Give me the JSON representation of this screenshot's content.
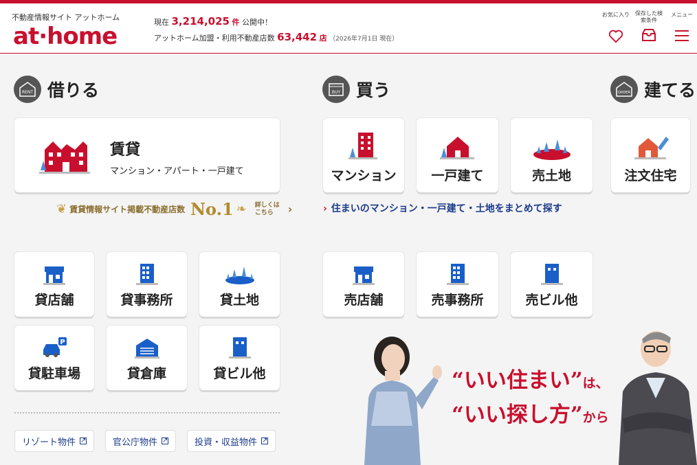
{
  "header": {
    "tagline": "不動産情報サイト アットホーム",
    "logo": "athome",
    "stats": {
      "prefix": "現在",
      "count": "3,214,025",
      "count_unit": "件",
      "public": "公開中！",
      "stores_label": "アットホーム加盟・利用不動産店数",
      "stores": "63,442",
      "stores_unit": "店",
      "as_of": "（2026年7月1日 現在）"
    },
    "icons": [
      {
        "label": "お気に入り",
        "icon": "heart-icon"
      },
      {
        "label": "保存した検索条件",
        "icon": "inbox-icon"
      },
      {
        "label": "メニュー",
        "icon": "menu-icon"
      }
    ]
  },
  "sections": {
    "rent": {
      "badge": "RENT",
      "title": "借りる"
    },
    "buy": {
      "badge": "BUY",
      "title": "買う"
    },
    "build": {
      "badge": "ORDER",
      "title": "建てる"
    }
  },
  "rent_main": {
    "title": "賃貸",
    "subtitle": "マンション・アパート・一戸建て"
  },
  "no1": {
    "text": "賃貸情報サイト掲載不動産店数",
    "rank": "No.1",
    "more": "詳しくはこちら"
  },
  "rent_cards": [
    "貸店舗",
    "貸事務所",
    "貸土地",
    "貸駐車場",
    "貸倉庫",
    "貸ビル他"
  ],
  "buy_cards": [
    "マンション",
    "一戸建て",
    "売土地"
  ],
  "build_cards": [
    "注文住宅"
  ],
  "buy_link": "住まいのマンション・一戸建て・土地をまとめて探す",
  "sell_cards": [
    "売店舗",
    "売事務所",
    "売ビル他"
  ],
  "links": [
    "リゾート物件",
    "官公庁物件",
    "投資・収益物件"
  ],
  "promo": {
    "line1a": "“いい住まい”",
    "line1b": "は、",
    "line2a": "“いい探し方”",
    "line2b": "から"
  },
  "colors": {
    "brand": "#c8102e",
    "blue": "#1a5fc8",
    "link": "#1b3b8a"
  }
}
